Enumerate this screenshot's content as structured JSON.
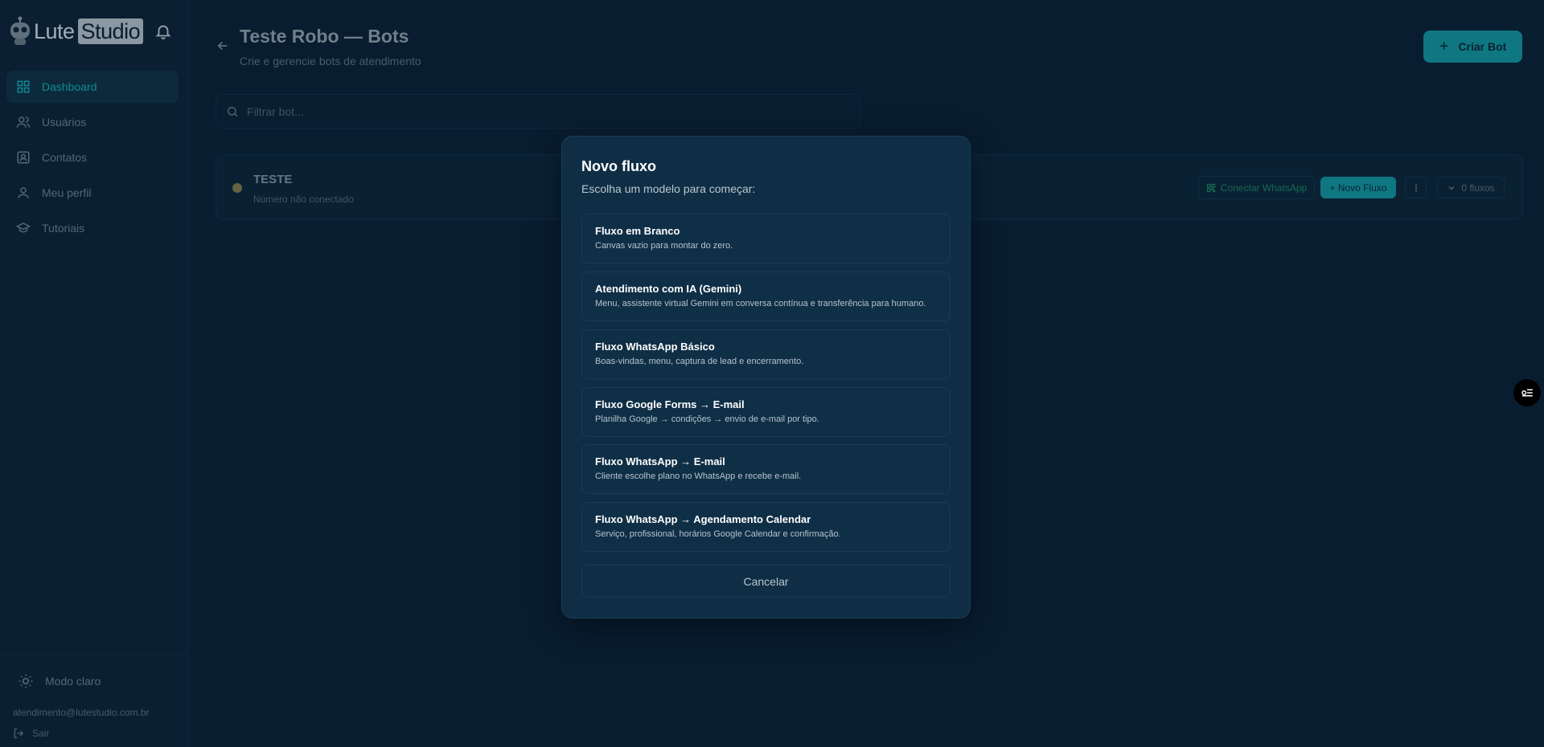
{
  "brand": {
    "name": "Lute",
    "name_box": "Studio"
  },
  "sidebar": {
    "items": [
      {
        "label": "Dashboard",
        "icon": "dashboard-icon",
        "active": true
      },
      {
        "label": "Usuários",
        "icon": "users-icon"
      },
      {
        "label": "Contatos",
        "icon": "contacts-icon"
      },
      {
        "label": "Meu perfil",
        "icon": "user-icon"
      },
      {
        "label": "Tutoriais",
        "icon": "graduation-cap-icon"
      }
    ],
    "theme_label": "Modo claro",
    "email": "atendimento@lutestudio.com.br",
    "logout_label": "Sair"
  },
  "header": {
    "title": "Teste Robo — Bots",
    "subtitle": "Crie e gerencie bots de atendimento",
    "create_label": "Criar Bot"
  },
  "search": {
    "placeholder": "Filtrar bot..."
  },
  "bot": {
    "name": "TESTE",
    "status": "Número não conectado",
    "connect_label": "Conectar WhatsApp",
    "new_flow_label": "+ Novo Fluxo",
    "flows_label": "0 fluxos"
  },
  "modal": {
    "title": "Novo fluxo",
    "subtitle": "Escolha um modelo para começar:",
    "options": [
      {
        "title": "Fluxo em Branco",
        "desc": "Canvas vazio para montar do zero."
      },
      {
        "title": "Atendimento com IA (Gemini)",
        "desc": "Menu, assistente virtual Gemini em conversa contínua e transferência para humano."
      },
      {
        "title": "Fluxo WhatsApp Básico",
        "desc": "Boas-vindas, menu, captura de lead e encerramento."
      },
      {
        "title": "Fluxo Google Forms → E-mail",
        "desc": "Planilha Google → condições → envio de e-mail por tipo."
      },
      {
        "title": "Fluxo WhatsApp → E-mail",
        "desc": "Cliente escolhe plano no WhatsApp e recebe e-mail."
      },
      {
        "title": "Fluxo WhatsApp → Agendamento Calendar",
        "desc": "Serviço, profissional, horários Google Calendar e confirmação."
      }
    ],
    "cancel_label": "Cancelar"
  },
  "colors": {
    "accent": "#139aa4",
    "background": "#0a2237",
    "modal": "#0f2e45"
  }
}
